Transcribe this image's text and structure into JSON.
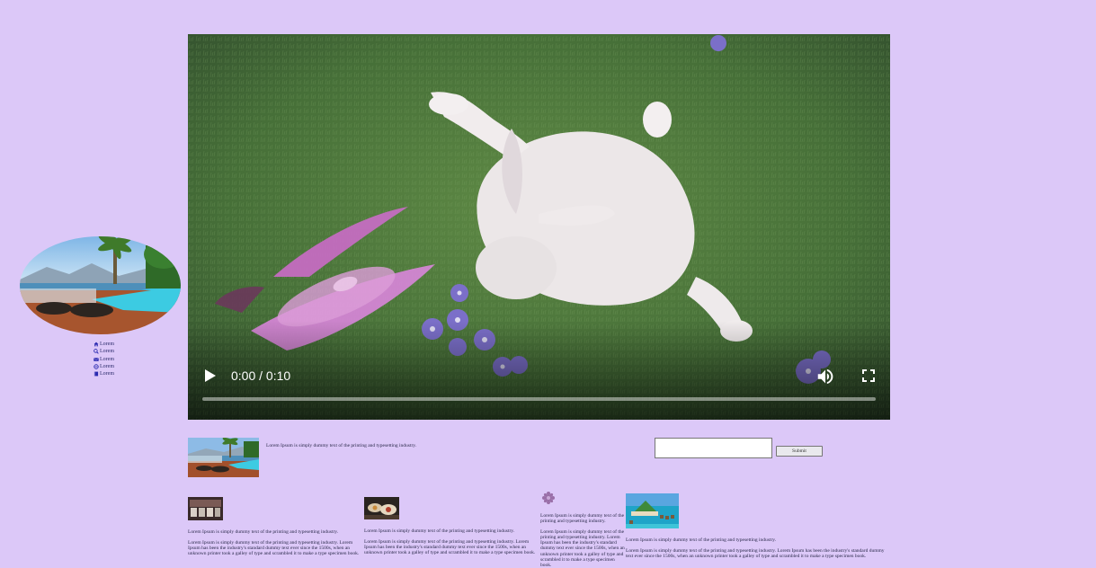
{
  "sidebar": {
    "nav": [
      {
        "label": "Lorem",
        "icon": "home-icon"
      },
      {
        "label": "Lorem",
        "icon": "search-icon"
      },
      {
        "label": "Lorem",
        "icon": "mail-icon"
      },
      {
        "label": "Lorem",
        "icon": "globe-icon"
      },
      {
        "label": "Lorem",
        "icon": "book-icon"
      }
    ]
  },
  "video": {
    "time": "0:00 / 0:10",
    "progress": 0
  },
  "info": {
    "text": "Lorem Ipsum is simply dummy text of the printing and typesetting industry."
  },
  "search": {
    "value": "",
    "submit_label": "Submit"
  },
  "articles": [
    {
      "intro": "Lorem Ipsum is simply dummy text of the printing and typesetting industry.",
      "body": "Lorem Ipsum is simply dummy text of the printing and typesetting industry. Lorem Ipsum has been the industry's standard dummy text ever since the 1500s, when an unknown printer took a galley of type and scrambled it to make a type specimen book."
    },
    {
      "intro": "Lorem Ipsum is simply dummy text of the printing and typesetting industry.",
      "body": "Lorem Ipsum is simply dummy text of the printing and typesetting industry. Lorem Ipsum has been the industry's standard dummy text ever since the 1500s, when an unknown printer took a galley of type and scrambled it to make a type specimen book."
    },
    {
      "intro": "Lorem Ipsum is simply dummy text of the printing and typesetting industry.",
      "body": "Lorem Ipsum is simply dummy text of the printing and typesetting industry. Lorem Ipsum has been the industry's standard dummy text ever since the 1500s, when an unknown printer took a galley of type and scrambled it to make a type specimen book."
    },
    {
      "intro": "Lorem Ipsum is simply dummy text of the printing and typesetting industry.",
      "body": "Lorem Ipsum is simply dummy text of the printing and typesetting industry. Lorem Ipsum has been the industry's standard dummy text ever since the 1500s, when an unknown printer took a galley of type and scrambled it to make a type specimen book."
    }
  ]
}
